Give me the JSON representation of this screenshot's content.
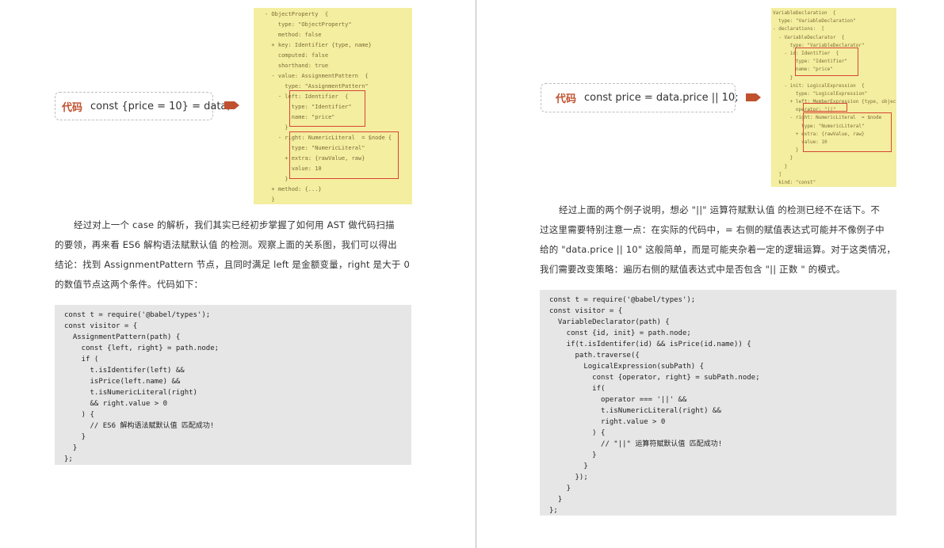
{
  "left": {
    "pill": {
      "tag": "代码",
      "code": "const {price = 10} = data;"
    },
    "ast_lines": [
      "- ObjectProperty  {",
      "    type: \"ObjectProperty\"",
      "    method: false",
      "  + key: Identifier {type, name}",
      "    computed: false",
      "    shorthand: true",
      "  - value: AssignmentPattern  {",
      "      type: \"AssignmentPattern\"",
      "    - left: Identifier  {",
      "        type: \"Identifier\"",
      "        name: \"price\"",
      "      }",
      "    - right: NumericLiteral  = $node {",
      "        type: \"NumericLiteral\"",
      "      + extra: {rawValue, raw}",
      "        value: 10",
      "      }",
      "  + method: {...}",
      "  }"
    ],
    "paragraph": [
      "经过对上一个 case 的解析，我们其实已经初步掌握了如何用 AST 做代码扫描",
      "的要领，再来看 ES6 解构语法赋默认值 的检测。观察上面的关系图，我们可以得出",
      "结论：找到 AssignmentPattern 节点，且同时满足 left 是金额变量，right 是大于 0",
      "的数值节点这两个条件。代码如下："
    ],
    "code": [
      "const t = require('@babel/types');",
      "const visitor = {",
      "  AssignmentPattern(path) {",
      "    const {left, right} = path.node;",
      "    if (",
      "      t.isIdentifer(left) &&",
      "      isPrice(left.name) &&",
      "      t.isNumericLiteral(right)",
      "      && right.value > 0",
      "    ) {",
      "      // ES6 解构语法赋默认值 匹配成功!",
      "    }",
      "  }",
      "};"
    ]
  },
  "right": {
    "pill": {
      "tag": "代码",
      "code": "const price = data.price || 10;"
    },
    "ast_lines": [
      "VariableDeclaration  {",
      "  type: \"VariableDeclaration\"",
      "- declarations:  [",
      "  - VariableDeclarator  {",
      "      type: \"VariableDeclarator\"",
      "    - id: Identifier  {",
      "        type: \"Identifier\"",
      "        name: \"price\"",
      "      }",
      "    - init: LogicalExpression  {",
      "        type: \"LogicalExpression\"",
      "      + left: MemberExpression {type, object",
      "        operator: \"||\"",
      "      - right: NumericLiteral  = $node",
      "          type: \"NumericLiteral\"",
      "        + extra: {rawValue, raw}",
      "          value: 10",
      "        }",
      "      }",
      "    }",
      "  ]",
      "  kind: \"const\""
    ],
    "paragraph": [
      "经过上面的两个例子说明，想必 \"||\" 运算符赋默认值 的检测已经不在话下。不",
      "过这里需要特别注意一点：在实际的代码中，= 右侧的赋值表达式可能并不像例子中",
      "给的 \"data.price || 10\" 这般简单，而是可能夹杂着一定的逻辑运算。对于这类情况，",
      "我们需要改变策略：遍历右侧的赋值表达式中是否包含 \"|| 正数 \" 的模式。"
    ],
    "code": [
      "const t = require('@babel/types');",
      "const visitor = {",
      "  VariableDeclarator(path) {",
      "    const {id, init} = path.node;",
      "    if(t.isIdentifer(id) && isPrice(id.name)) {",
      "      path.traverse({",
      "        LogicalExpression(subPath) {",
      "          const {operator, right} = subPath.node;",
      "          if(",
      "            operator === '||' &&",
      "            t.isNumericLiteral(right) &&",
      "            right.value > 0",
      "          ) {",
      "            // \"||\" 运算符赋默认值 匹配成功!",
      "          }",
      "        }",
      "      });",
      "    }",
      "  }",
      "};"
    ]
  },
  "colors": {
    "accent": "#c0512f",
    "ast_bg": "#f4eea0",
    "highlight_box": "#d64535",
    "code_bg": "#e6e6e6"
  }
}
